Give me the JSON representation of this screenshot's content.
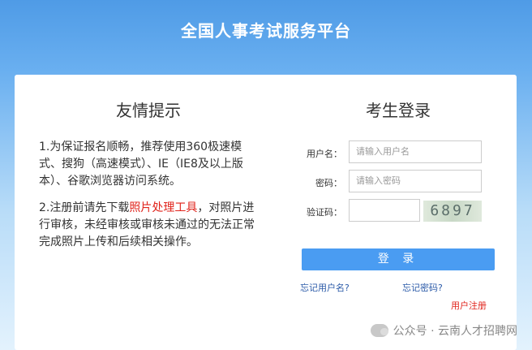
{
  "header": {
    "title": "全国人事考试服务平台"
  },
  "tips": {
    "title": "友情提示",
    "item1": "1.为保证报名顺畅，推荐使用360极速模式、搜狗（高速模式）、IE（IE8及以上版本）、谷歌浏览器访问系统。",
    "item2_before": "2.注册前请先下载",
    "item2_link": "照片处理工具",
    "item2_after": "，对照片进行审核，未经审核或审核未通过的无法正常完成照片上传和后续相关操作。"
  },
  "login": {
    "title": "考生登录",
    "username_label": "用户名：",
    "username_placeholder": "请输入用户名",
    "password_label": "密码：",
    "password_placeholder": "请输入密码",
    "captcha_label": "验证码：",
    "captcha_text": "6897",
    "submit_label": "登 录",
    "forgot_username": "忘记用户名?",
    "forgot_password": "忘记密码?",
    "register": "用户注册"
  },
  "watermark": {
    "text": "公众号 · 云南人才招聘网",
    "icon": "wechat-icon"
  }
}
